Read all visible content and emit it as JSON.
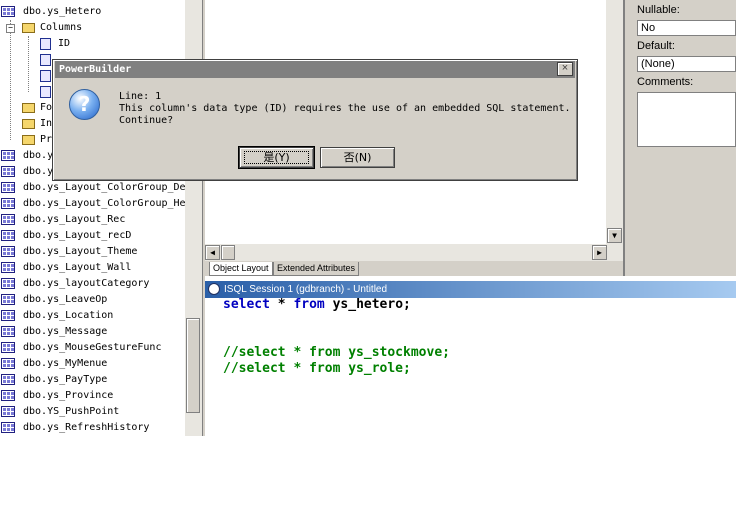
{
  "tree": {
    "items": [
      {
        "label": "dbo.ys_Hetero",
        "icon": "table-icon",
        "indent": 0
      },
      {
        "label": "Columns",
        "icon": "folder-icon",
        "indent": 1
      },
      {
        "label": "ID",
        "icon": "column-icon",
        "indent": 2
      },
      {
        "label": "",
        "icon": "column-icon",
        "indent": 2
      },
      {
        "label": "",
        "icon": "column-icon",
        "indent": 2
      },
      {
        "label": "",
        "icon": "column-icon",
        "indent": 2
      },
      {
        "label": "Fo",
        "icon": "folder-icon",
        "indent": 1
      },
      {
        "label": "In",
        "icon": "folder-icon",
        "indent": 1
      },
      {
        "label": "Pr",
        "icon": "folder-icon",
        "indent": 1
      },
      {
        "label": "dbo.ys",
        "icon": "table-icon",
        "indent": 0
      },
      {
        "label": "dbo.y",
        "icon": "table-icon",
        "indent": 0
      },
      {
        "label": "dbo.ys_Layout_ColorGroup_De",
        "icon": "table-icon",
        "indent": 0
      },
      {
        "label": "dbo.ys_Layout_ColorGroup_He",
        "icon": "table-icon",
        "indent": 0
      },
      {
        "label": "dbo.ys_Layout_Rec",
        "icon": "table-icon",
        "indent": 0
      },
      {
        "label": "dbo.ys_Layout_recD",
        "icon": "table-icon",
        "indent": 0
      },
      {
        "label": "dbo.ys_Layout_Theme",
        "icon": "table-icon",
        "indent": 0
      },
      {
        "label": "dbo.ys_Layout_Wall",
        "icon": "table-icon",
        "indent": 0
      },
      {
        "label": "dbo.ys_layoutCategory",
        "icon": "table-icon",
        "indent": 0
      },
      {
        "label": "dbo.ys_LeaveOp",
        "icon": "table-icon",
        "indent": 0
      },
      {
        "label": "dbo.ys_Location",
        "icon": "table-icon",
        "indent": 0
      },
      {
        "label": "dbo.ys_Message",
        "icon": "table-icon",
        "indent": 0
      },
      {
        "label": "dbo.ys_MouseGestureFunc",
        "icon": "table-icon",
        "indent": 0
      },
      {
        "label": "dbo.ys_MyMenue",
        "icon": "table-icon",
        "indent": 0
      },
      {
        "label": "dbo.ys_PayType",
        "icon": "table-icon",
        "indent": 0
      },
      {
        "label": "dbo.ys_Province",
        "icon": "table-icon",
        "indent": 0
      },
      {
        "label": "dbo.YS_PushPoint",
        "icon": "table-icon",
        "indent": 0
      },
      {
        "label": "dbo.ys_RefreshHistory",
        "icon": "table-icon",
        "indent": 0
      }
    ]
  },
  "layout_tabs": [
    "Object Layout",
    "Extended Attributes"
  ],
  "properties": {
    "nullable_label": "Nullable:",
    "nullable_value": "No",
    "default_label": "Default:",
    "default_value": "(None)",
    "comments_label": "Comments:"
  },
  "sql": {
    "title": "ISQL Session 1 (gdbranch) - Untitled",
    "lines": [
      {
        "parts": [
          {
            "t": "select",
            "c": "kw"
          },
          {
            "t": " * ",
            "c": ""
          },
          {
            "t": "from",
            "c": "kw"
          },
          {
            "t": " ys_hetero;",
            "c": ""
          }
        ]
      },
      {
        "parts": []
      },
      {
        "parts": []
      },
      {
        "parts": [
          {
            "t": "//select * from ys_stockmove;",
            "c": "cm"
          }
        ]
      },
      {
        "parts": [
          {
            "t": "//select * from ys_role;",
            "c": "cm"
          }
        ]
      }
    ]
  },
  "dialog": {
    "title": "PowerBuilder",
    "close_glyph": "×",
    "icon_glyph": "?",
    "line1": "Line: 1",
    "line2": "This column's data type (ID) requires the use of an embedded SQL statement.",
    "line3": "Continue?",
    "yes_label": "是(Y)",
    "no_label": "否(N)"
  }
}
